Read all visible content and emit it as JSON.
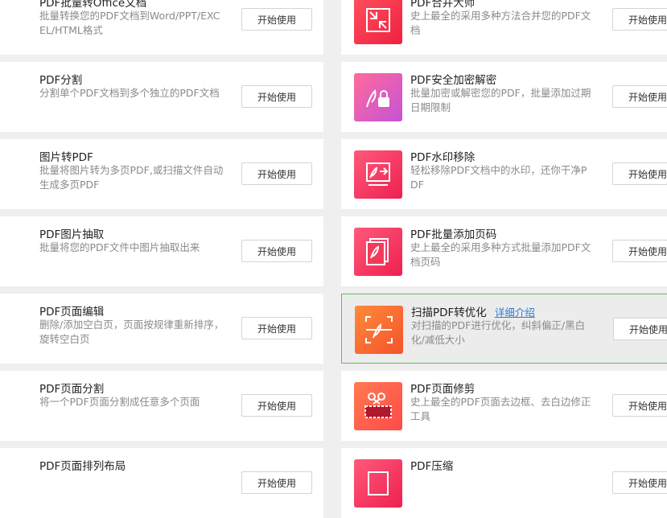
{
  "cards": [
    {
      "title": "PDF批量转Office文档",
      "desc": "批量转换您的PDF文档到Word/PPT/EXCEL/HTML格式",
      "button": "开始使用",
      "icon": "word-convert-icon"
    },
    {
      "title": "PDF合并大师",
      "desc": "史上最全的采用多种方法合并您的PDF文档",
      "button": "开始使用",
      "icon": "merge-icon"
    },
    {
      "title": "PDF分割",
      "desc": "分割单个PDF文档到多个独立的PDF文档",
      "button": "开始使用",
      "icon": "split-icon"
    },
    {
      "title": "PDF安全加密解密",
      "desc": "批量加密或解密您的PDF，批量添加过期日期限制",
      "button": "开始使用",
      "icon": "lock-icon"
    },
    {
      "title": "图片转PDF",
      "desc": "批量将图片转为多页PDF,或扫描文件自动生成多页PDF",
      "button": "开始使用",
      "icon": "image-to-pdf-icon"
    },
    {
      "title": "PDF水印移除",
      "desc": "轻松移除PDF文档中的水印，还你干净PDF",
      "button": "开始使用",
      "icon": "watermark-remove-icon"
    },
    {
      "title": "PDF图片抽取",
      "desc": "批量将您的PDF文件中图片抽取出来",
      "button": "开始使用",
      "icon": "image-extract-icon"
    },
    {
      "title": "PDF批量添加页码",
      "desc": "史上最全的采用多种方式批量添加PDF文档页码",
      "button": "开始使用",
      "icon": "page-number-icon"
    },
    {
      "title": "PDF页面编辑",
      "desc": "删除/添加空白页，页面按规律重新排序，旋转空白页",
      "button": "开始使用",
      "icon": "page-edit-icon"
    },
    {
      "title": "扫描PDF转优化",
      "desc": "对扫描的PDF进行优化，纠斜偏正/黑白化/减低大小",
      "button": "开始使用",
      "icon": "scan-optimize-icon",
      "link": "详细介绍"
    },
    {
      "title": "PDF页面分割",
      "desc": "将一个PDF页面分割成任意多个页面",
      "button": "开始使用",
      "icon": "page-split-icon"
    },
    {
      "title": "PDF页面修剪",
      "desc": "史上最全的PDF页面去边框、去白边修正工具",
      "button": "开始使用",
      "icon": "page-crop-icon"
    },
    {
      "title": "PDF页面排列布局",
      "desc": "",
      "button": "开始使用",
      "icon": "page-layout-icon"
    },
    {
      "title": "PDF压缩",
      "desc": "",
      "button": "开始使用",
      "icon": "compress-icon"
    }
  ]
}
